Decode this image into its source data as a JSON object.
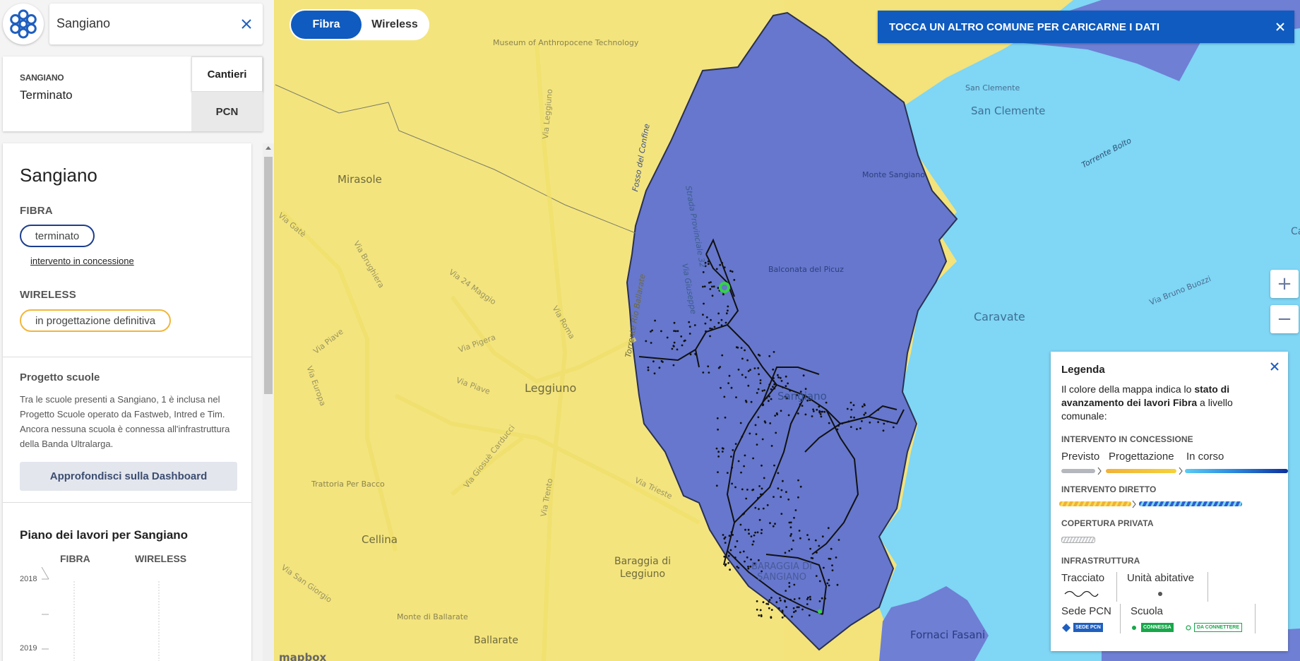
{
  "search": {
    "value": "Sangiano"
  },
  "status": {
    "comune": "SANGIANO",
    "value": "Terminato",
    "tabs": [
      "Cantieri",
      "PCN"
    ]
  },
  "detail": {
    "title": "Sangiano",
    "fibra_label": "FIBRA",
    "fibra_status": "terminato",
    "fibra_link": "intervento in concessione",
    "wireless_label": "WIRELESS",
    "wireless_status": "in progettazione definitiva",
    "scuole_title": "Progetto scuole",
    "scuole_text": "Tra le scuole presenti a Sangiano, 1 è inclusa nel Progetto Scuole operato da Fastweb, Intred e Tim. Ancora nessuna scuola è connessa all'infrastruttura della Banda Ultralarga.",
    "dashboard_button": "Approfondisci sulla Dashboard",
    "plan_title": "Piano dei lavori per Sangiano",
    "plan_cols": [
      "FIBRA",
      "WIRELESS"
    ],
    "plan_years": [
      "2018",
      "2019"
    ]
  },
  "map_toggle": {
    "active": "Fibra",
    "inactive": "Wireless"
  },
  "banner": {
    "text": "TOCCA UN ALTRO COMUNE PER CARICARNE I DATI"
  },
  "zoom": {
    "in": "+",
    "out": "−"
  },
  "legend": {
    "title": "Legenda",
    "desc_prefix": "Il colore della mappa indica lo ",
    "desc_bold": "stato di avanzamento dei lavori Fibra",
    "desc_suffix": " a livello comunale:",
    "concessione": {
      "label": "INTERVENTO IN CONCESSIONE",
      "items": [
        "Previsto",
        "Progettazione",
        "In corso"
      ]
    },
    "diretto": {
      "label": "INTERVENTO DIRETTO"
    },
    "privata": {
      "label": "COPERTURA PRIVATA"
    },
    "infra": {
      "label": "INFRASTRUTTURA",
      "items": [
        "Tracciato",
        "Unità abitative",
        "Sede PCN",
        "Scuola"
      ]
    },
    "badges": {
      "pcn": "SEDE PCN",
      "connessa": "CONNESSA",
      "da_connettere": "DA CONNETTERE"
    }
  },
  "map_labels": {
    "museum": "Museum of Anthropocene Technology",
    "mirasole": "Mirasole",
    "leggiuno": "Leggiuno",
    "cellina": "Cellina",
    "baraggia": "Baraggia di Leggiuno",
    "ballarate": "Ballarate",
    "monte_ballarate": "Monte di Ballarate",
    "trattoria": "Trattoria Per Bacco",
    "sangiano": "Sangiano",
    "baraggia_sangiano": "BARAGGIA DI SANGIANO",
    "monte_sangiano": "Monte Sangiano",
    "balconata": "Balconata del Picuz",
    "san_clemente_small": "San Clemente",
    "san_clemente": "San Clemente",
    "caravate": "Caravate",
    "fornaci": "Fornaci Fasani",
    "torrente_bolto": "Torrente Bolto",
    "via_bruno_buozzi": "Via Bruno Buozzi",
    "fosso": "Fosso del Confine",
    "strada_prov": "Strada Provinciale 32",
    "torrente_rio": "Torrente Rio Ballarate",
    "via_gate": "Via Gatè",
    "via_brughiera": "Via Brughiera",
    "via_piave1": "Via Piave",
    "via_europa": "Via Europa",
    "via_24_maggio": "Via 24 Maggio",
    "via_pigera": "Via Pigera",
    "via_roma": "Via Roma",
    "via_piave2": "Via Piave",
    "via_giosue": "Via Giosuè Carducci",
    "via_trento": "Via Trento",
    "via_trieste": "Via Trieste",
    "via_san_giorgio": "Via San Giorgio",
    "via_leggiuno": "Via Leggiuno",
    "via_giuseppe": "Via Giuseppe",
    "ca": "Ca",
    "mapbox": "mapbox"
  }
}
